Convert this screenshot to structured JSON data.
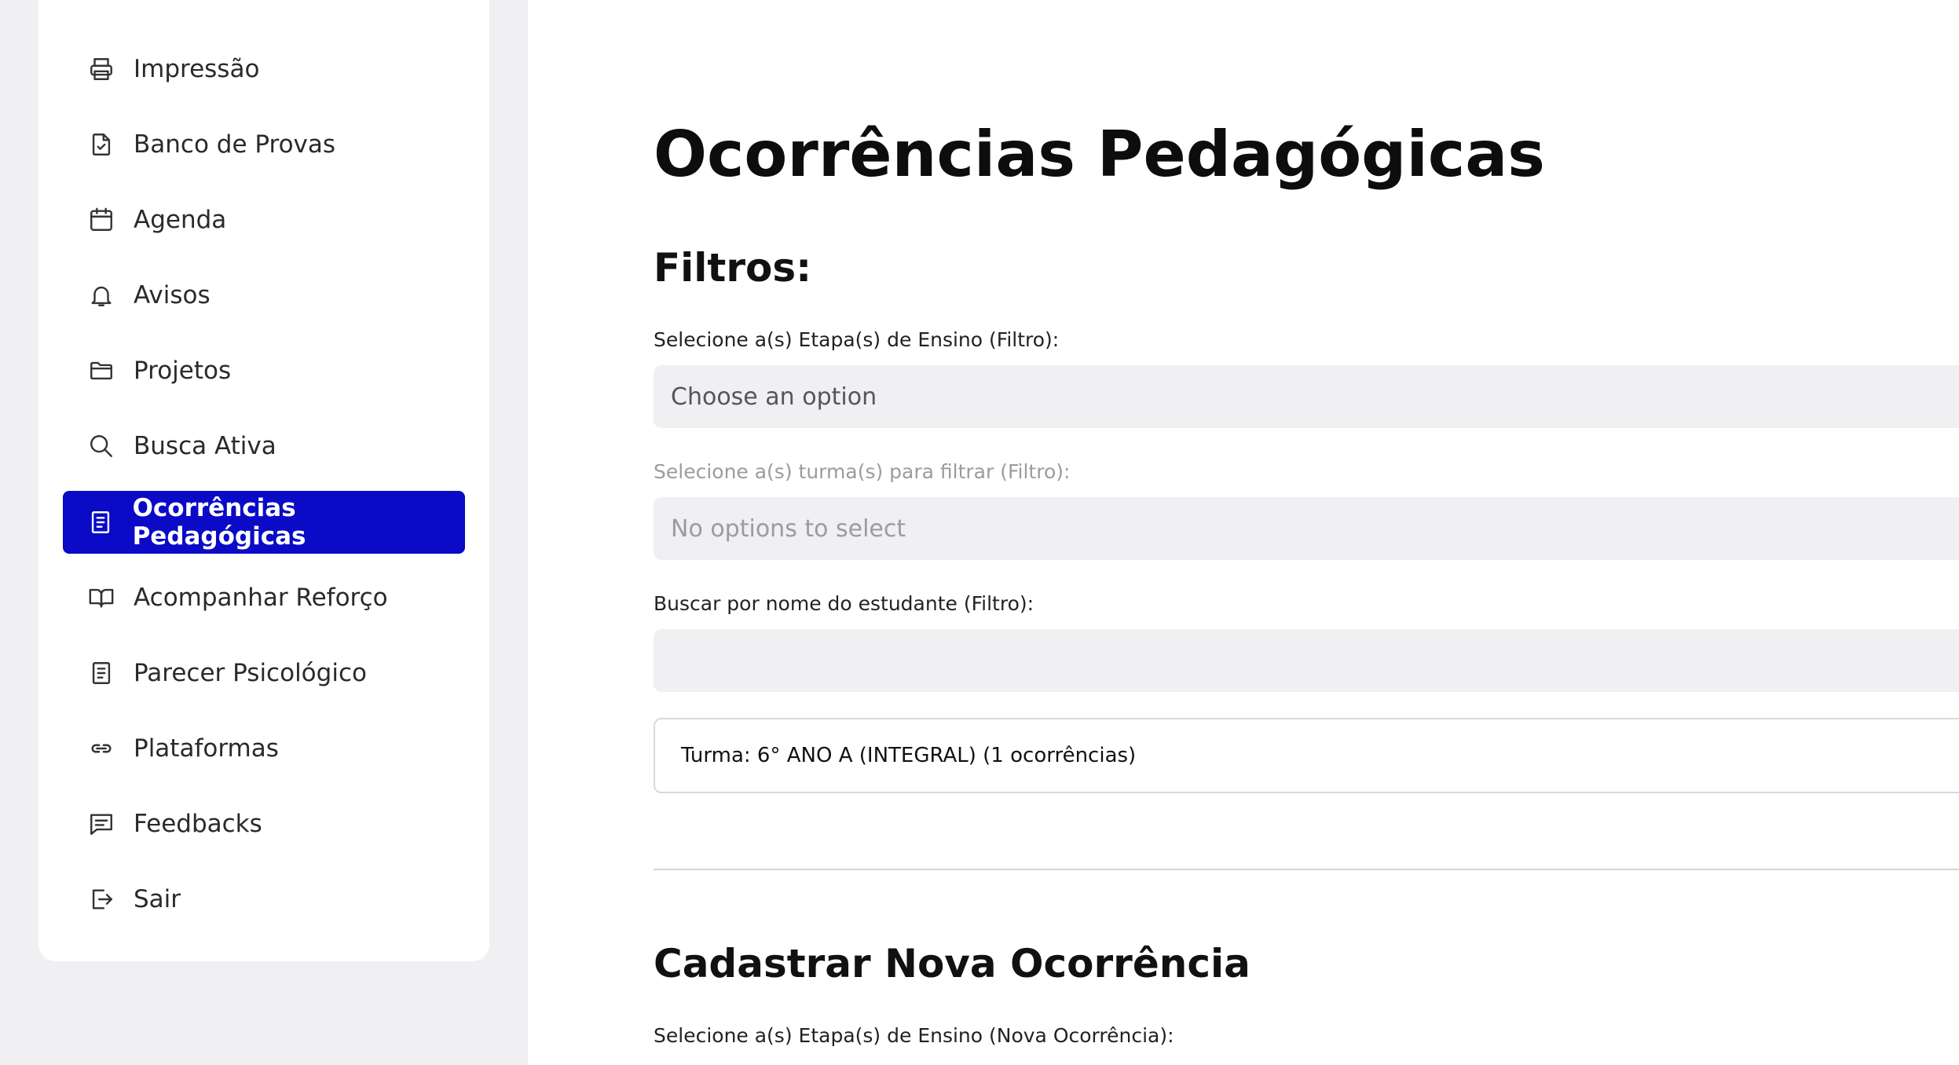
{
  "sidebar": {
    "items": [
      {
        "label": "Impressão",
        "icon": "printer-icon",
        "active": false
      },
      {
        "label": "Banco de Provas",
        "icon": "file-check-icon",
        "active": false
      },
      {
        "label": "Agenda",
        "icon": "calendar-icon",
        "active": false
      },
      {
        "label": "Avisos",
        "icon": "bell-icon",
        "active": false
      },
      {
        "label": "Projetos",
        "icon": "folder-icon",
        "active": false
      },
      {
        "label": "Busca Ativa",
        "icon": "search-icon",
        "active": false
      },
      {
        "label": "Ocorrências Pedagógicas",
        "icon": "document-icon",
        "active": true
      },
      {
        "label": "Acompanhar Reforço",
        "icon": "book-icon",
        "active": false
      },
      {
        "label": "Parecer Psicológico",
        "icon": "document-icon",
        "active": false
      },
      {
        "label": "Plataformas",
        "icon": "link-icon",
        "active": false
      },
      {
        "label": "Feedbacks",
        "icon": "chat-icon",
        "active": false
      },
      {
        "label": "Sair",
        "icon": "logout-icon",
        "active": false
      }
    ],
    "active_color": "#0a0ac7"
  },
  "main": {
    "title": "Ocorrências Pedagógicas",
    "filters": {
      "heading": "Filtros:",
      "etapa_label": "Selecione a(s) Etapa(s) de Ensino (Filtro):",
      "etapa_placeholder": "Choose an option",
      "turma_label": "Selecione a(s) turma(s) para filtrar (Filtro):",
      "turma_placeholder": "No options to select",
      "nome_label": "Buscar por nome do estudante (Filtro):",
      "nome_value": ""
    },
    "results": {
      "expander_label": "Turma: 6° ANO A (INTEGRAL) (1 ocorrências)"
    },
    "new_entry": {
      "heading": "Cadastrar Nova Ocorrência",
      "etapa_label": "Selecione a(s) Etapa(s) de Ensino (Nova Ocorrência):"
    }
  }
}
